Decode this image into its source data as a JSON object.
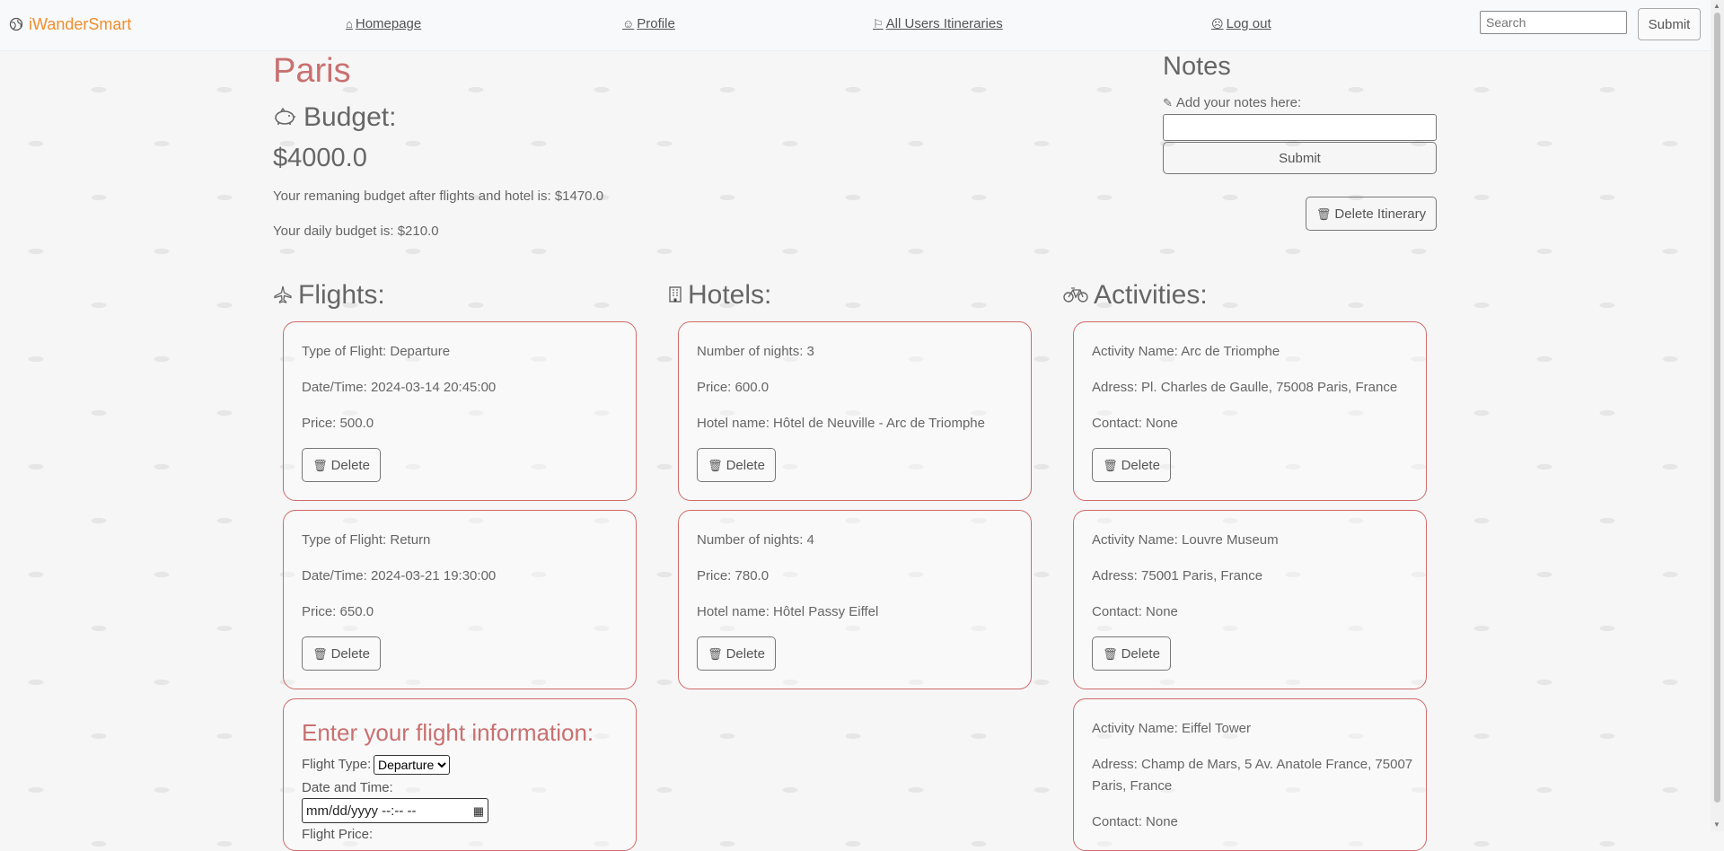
{
  "nav": {
    "brand": "iWanderSmart",
    "homepage": "Homepage",
    "profile": "Profile",
    "all_itineraries": "All Users Itineraries",
    "logout": "Log out",
    "search_placeholder": "Search",
    "search_button": "Submit"
  },
  "itinerary": {
    "city": "Paris",
    "budget_heading": "Budget:",
    "budget_value": "$4000.0",
    "remaining_text": "Your remaning budget after flights and hotel is: $1470.0",
    "daily_text": "Your daily budget is: $210.0"
  },
  "notes": {
    "heading": "Notes",
    "label": "Add your notes here:",
    "submit": "Submit",
    "delete_itinerary": "Delete Itinerary"
  },
  "flights": {
    "heading": "Flights:",
    "items": [
      {
        "type": "Type of Flight: Departure",
        "datetime": "Date/Time: 2024-03-14 20:45:00",
        "price": "Price: 500.0",
        "delete": "Delete"
      },
      {
        "type": "Type of Flight: Return",
        "datetime": "Date/Time: 2024-03-21 19:30:00",
        "price": "Price: 650.0",
        "delete": "Delete"
      }
    ],
    "form": {
      "title": "Enter your flight information:",
      "type_label": "Flight Type:",
      "type_selected": "Departure",
      "datetime_label": "Date and Time:",
      "datetime_placeholder": "mm/dd/yyyy --:-- --",
      "next_label": "Flight Price:"
    }
  },
  "hotels": {
    "heading": "Hotels:",
    "items": [
      {
        "nights": "Number of nights: 3",
        "price": "Price: 600.0",
        "name": "Hotel name: Hôtel de Neuville - Arc de Triomphe",
        "delete": "Delete"
      },
      {
        "nights": "Number of nights: 4",
        "price": "Price: 780.0",
        "name": "Hotel name: Hôtel Passy Eiffel",
        "delete": "Delete"
      }
    ]
  },
  "activities": {
    "heading": "Activities:",
    "items": [
      {
        "name": "Activity Name: Arc de Triomphe",
        "address": "Adress: Pl. Charles de Gaulle, 75008 Paris, France",
        "contact": "Contact: None",
        "delete": "Delete"
      },
      {
        "name": "Activity Name: Louvre Museum",
        "address": "Adress: 75001 Paris, France",
        "contact": "Contact: None",
        "delete": "Delete"
      },
      {
        "name": "Activity Name: Eiffel Tower",
        "address_line1": "Adress: Champ de Mars, 5 Av. Anatole France, 75007",
        "address_line2": "Paris, France",
        "contact": "Contact: None"
      }
    ]
  },
  "colors": {
    "brand": "#ef8e2e",
    "accent": "#c97070",
    "card_border": "#d06a6a"
  }
}
